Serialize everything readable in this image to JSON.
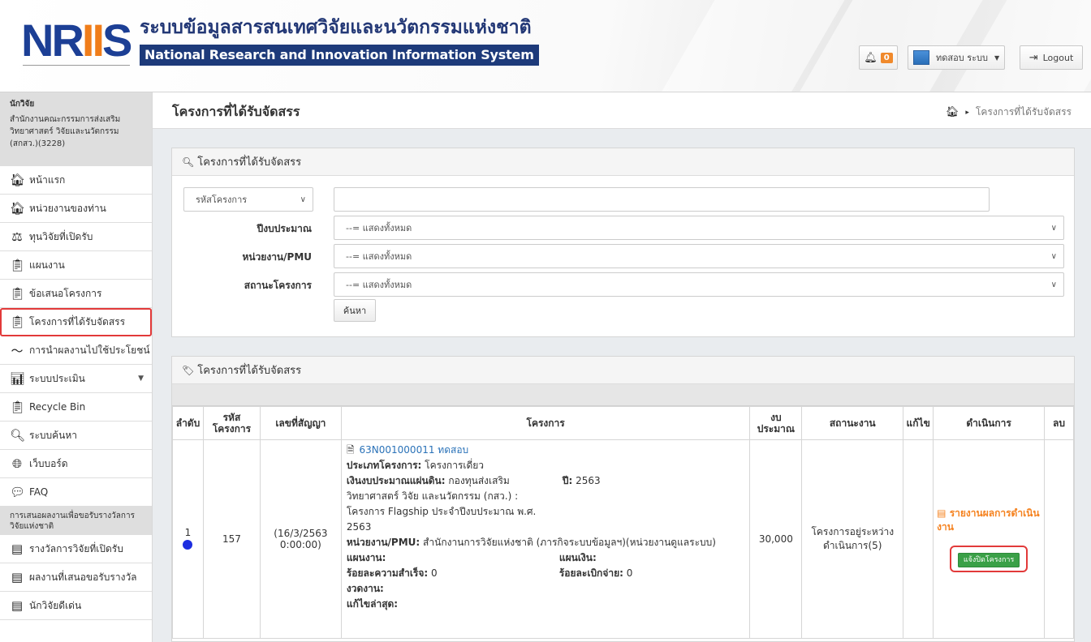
{
  "header": {
    "logo_text": "NRIIS",
    "title_th": "ระบบข้อมูลสารสนเทศวิจัยและนวัตกรรมแห่งชาติ",
    "title_en": "National Research and Innovation Information System",
    "notification_count": "0",
    "user_name": "ทดสอบ ระบบ",
    "logout_label": "Logout"
  },
  "sidebar": {
    "role": "นักวิจัย",
    "org": "สำนักงานคณะกรรมการส่งเสริมวิทยาศาสตร์ วิจัยและนวัตกรรม (สกสว.)(3228)",
    "items": [
      {
        "label": "หน้าแรก",
        "icon": "home-icon"
      },
      {
        "label": "หน่วยงานของท่าน",
        "icon": "home-icon"
      },
      {
        "label": "ทุนวิจัยที่เปิดรับ",
        "icon": "gavel-icon"
      },
      {
        "label": "แผนงาน",
        "icon": "clipboard-icon"
      },
      {
        "label": "ข้อเสนอโครงการ",
        "icon": "clipboard-icon"
      },
      {
        "label": "โครงการที่ได้รับจัดสรร",
        "icon": "clipboard-icon"
      },
      {
        "label": "การนำผลงานไปใช้ประโยชน์",
        "icon": "line-chart-icon"
      },
      {
        "label": "ระบบประเมิน",
        "icon": "bar-chart-icon"
      },
      {
        "label": "Recycle Bin",
        "icon": "clipboard-icon"
      },
      {
        "label": "ระบบค้นหา",
        "icon": "search-icon"
      },
      {
        "label": "เว็บบอร์ด",
        "icon": "globe-icon"
      },
      {
        "label": "FAQ",
        "icon": "comment-icon"
      }
    ],
    "section_title": "การเสนอผลงานเพื่อขอรับรางวัลการวิจัยแห่งชาติ",
    "section_items": [
      {
        "label": "รางวัลการวิจัยที่เปิดรับ",
        "icon": "list-icon"
      },
      {
        "label": "ผลงานที่เสนอขอรับรางวัล",
        "icon": "list-icon"
      },
      {
        "label": "นักวิจัยดีเด่น",
        "icon": "list-icon"
      }
    ]
  },
  "page": {
    "title": "โครงการที่ได้รับจัดสรร",
    "breadcrumb_current": "โครงการที่ได้รับจัดสรร"
  },
  "search": {
    "panel_title": "โครงการที่ได้รับจัดสรร",
    "type_select": "รหัสโครงการ",
    "keyword_value": "",
    "fields": [
      {
        "label": "ปีงบประมาณ",
        "value": "--= แสดงทั้งหมด"
      },
      {
        "label": "หน่วยงาน/PMU",
        "value": "--= แสดงทั้งหมด"
      },
      {
        "label": "สถานะโครงการ",
        "value": "--= แสดงทั้งหมด"
      }
    ],
    "button_label": "ค้นหา"
  },
  "list": {
    "panel_title": "โครงการที่ได้รับจัดสรร",
    "columns": {
      "order": "ลำดับ",
      "code": "รหัส โครงการ",
      "contract": "เลขที่สัญญา",
      "project": "โครงการ",
      "budget": "งบ ประมาณ",
      "status": "สถานะงาน",
      "edit": "แก้ไข",
      "action": "ดำเนินการ",
      "delete": "ลบ"
    },
    "rows": [
      {
        "order": "1",
        "code": "157",
        "contract": "(16/3/2563 0:00:00)",
        "project_link": "63N001000011 ทดสอบ",
        "project_type_label": "ประเภทโครงการ:",
        "project_type": "โครงการเดี่ยว",
        "fund_label": "เงินงบประมาณแผ่นดิน:",
        "fund": "กองทุนส่งเสริมวิทยาศาสตร์ วิจัย และนวัตกรรม (กสว.) : โครงการ Flagship ประจำปีงบประมาณ พ.ศ. 2563",
        "year_label": "ปี:",
        "year": "2563",
        "unit_label": "หน่วยงาน/PMU:",
        "unit": "สำนักงานการวิจัยแห่งชาติ (ภารกิจระบบข้อมูลฯ)(หน่วยงานดูแลระบบ)",
        "plan_label": "แผนงาน:",
        "plan": "",
        "money_plan_label": "แผนเงิน:",
        "money_plan": "",
        "success_label": "ร้อยละความสำเร็จ:",
        "success": "0",
        "disburse_label": "ร้อยละเบิกจ่าย:",
        "disburse": "0",
        "period_label": "งวดงาน:",
        "period": "",
        "last_edit_label": "แก้ไขล่าสุด:",
        "last_edit": "",
        "budget": "30,000",
        "status": "โครงการอยู่ระหว่างดำเนินการ(5)",
        "report_link": "รายงานผลการดำเนินงาน",
        "close_button": "แจ้งปิดโครงการ"
      }
    ]
  }
}
